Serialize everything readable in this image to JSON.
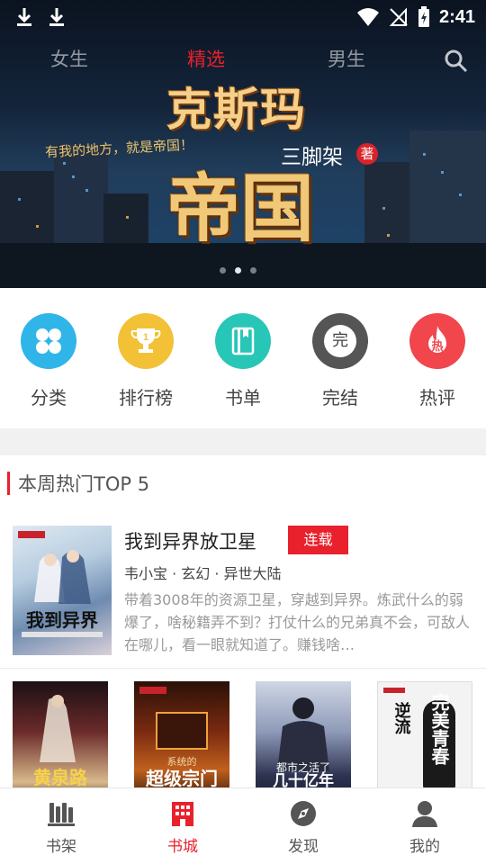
{
  "status_bar": {
    "time": "2:41"
  },
  "top_tabs": [
    {
      "label": "女生"
    },
    {
      "label": "精选",
      "active": true
    },
    {
      "label": "男生"
    }
  ],
  "banner": {
    "book_title_line1": "克斯玛",
    "book_title_line2": "帝国",
    "slogan": "有我的地方，就是帝国！",
    "author": "三脚架",
    "author_badge": "著",
    "dots_count": 3
  },
  "categories": [
    {
      "label": "分类",
      "icon": "clover-icon",
      "color": "#2fb5e8"
    },
    {
      "label": "排行榜",
      "icon": "trophy-icon",
      "color": "#f3c136",
      "badge": "1"
    },
    {
      "label": "书单",
      "icon": "book-icon",
      "color": "#28c6b6"
    },
    {
      "label": "完结",
      "icon": "completed-icon",
      "color": "#555555",
      "badge": "完"
    },
    {
      "label": "热评",
      "icon": "hot-comment-icon",
      "color": "#f0464c",
      "badge": "热"
    }
  ],
  "hot_section": {
    "title": "本周热门TOP 5",
    "featured": {
      "title": "我到异界放卫星",
      "status": "连载",
      "meta": "韦小宝 · 玄幻 · 异世大陆",
      "description": "带着3008年的资源卫星，穿越到异界。炼武什么的弱爆了，啥秘籍弄不到？打仗什么的兄弟真不会，可敌人在哪儿，看一眼就知道了。赚钱啥…",
      "cover_text": "我到异界"
    },
    "more_covers": [
      {
        "cover_text": "黄泉路"
      },
      {
        "cover_text": "超级宗门",
        "subtitle": "系统的"
      },
      {
        "cover_text": "几十亿年",
        "subtitle": "都市之活了"
      },
      {
        "cover_text": "完美青春",
        "subtitle": "逆流"
      }
    ]
  },
  "bottom_nav": [
    {
      "label": "书架",
      "icon": "bookshelf-icon"
    },
    {
      "label": "书城",
      "icon": "bookstore-icon",
      "active": true
    },
    {
      "label": "发现",
      "icon": "compass-icon"
    },
    {
      "label": "我的",
      "icon": "profile-icon"
    }
  ],
  "colors": {
    "accent": "#e8212d"
  }
}
